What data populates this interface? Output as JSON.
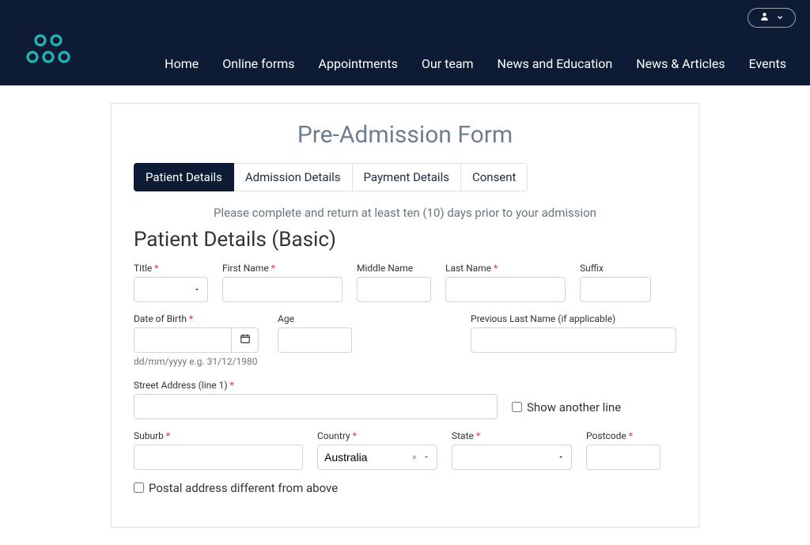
{
  "nav": {
    "items": [
      "Home",
      "Online forms",
      "Appointments",
      "Our team",
      "News and Education",
      "News & Articles",
      "Events"
    ]
  },
  "account_menu_icon": "user",
  "form": {
    "title": "Pre-Admission Form",
    "tabs": [
      {
        "label": "Patient Details",
        "active": true
      },
      {
        "label": "Admission Details",
        "active": false
      },
      {
        "label": "Payment Details",
        "active": false
      },
      {
        "label": "Consent",
        "active": false
      }
    ],
    "note": "Please complete and return at least ten (10) days prior to your admission",
    "section_heading": "Patient Details (Basic)",
    "fields": {
      "title": {
        "label": "Title",
        "required": true,
        "value": ""
      },
      "first_name": {
        "label": "First Name",
        "required": true,
        "value": ""
      },
      "middle_name": {
        "label": "Middle Name",
        "required": false,
        "value": ""
      },
      "last_name": {
        "label": "Last Name",
        "required": true,
        "value": ""
      },
      "suffix": {
        "label": "Suffix",
        "required": false,
        "value": ""
      },
      "dob": {
        "label": "Date of Birth",
        "required": true,
        "value": "",
        "help": "dd/mm/yyyy e.g. 31/12/1980"
      },
      "age": {
        "label": "Age",
        "required": false,
        "value": "",
        "readonly": true
      },
      "prev_last": {
        "label": "Previous Last Name (if applicable)",
        "required": false,
        "value": ""
      },
      "street1": {
        "label": "Street Address (line 1)",
        "required": true,
        "value": ""
      },
      "show_another_line": {
        "label": "Show another line",
        "checked": false
      },
      "suburb": {
        "label": "Suburb",
        "required": true,
        "value": ""
      },
      "country": {
        "label": "Country",
        "required": true,
        "value": "Australia"
      },
      "state": {
        "label": "State",
        "required": true,
        "value": ""
      },
      "postcode": {
        "label": "Postcode",
        "required": true,
        "value": ""
      },
      "postal_diff": {
        "label": "Postal address different from above",
        "checked": false
      }
    }
  }
}
